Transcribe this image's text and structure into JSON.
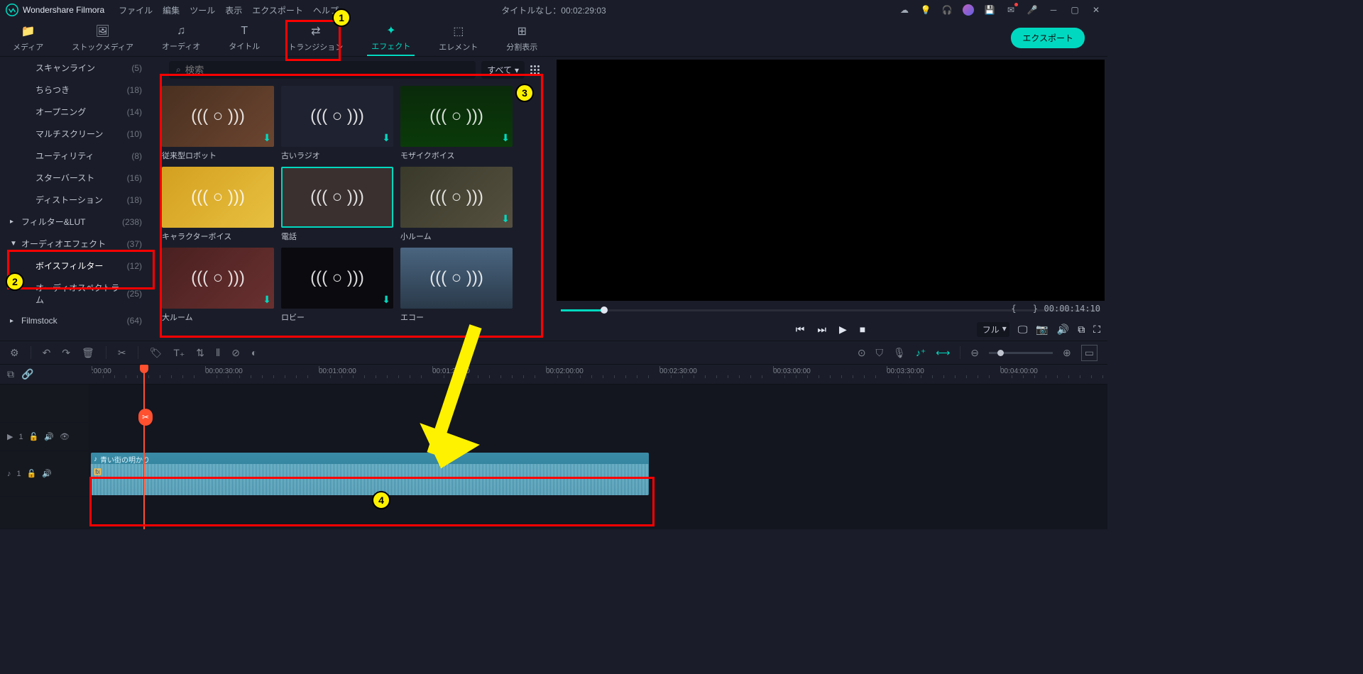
{
  "app": {
    "name": "Wondershare Filmora",
    "title": "タイトルなし：00:02:29:03"
  },
  "menu": [
    "ファイル",
    "編集",
    "ツール",
    "表示",
    "エクスポート",
    "ヘルプ"
  ],
  "tabs": [
    {
      "label": "メディア"
    },
    {
      "label": "ストックメディア"
    },
    {
      "label": "オーディオ"
    },
    {
      "label": "タイトル"
    },
    {
      "label": "トランジション"
    },
    {
      "label": "エフェクト",
      "active": true
    },
    {
      "label": "エレメント"
    },
    {
      "label": "分割表示"
    }
  ],
  "export_btn": "エクスポート",
  "search": {
    "placeholder": "検索",
    "filter_label": "すべて"
  },
  "sidebar": {
    "items": [
      {
        "label": "スキャンライン",
        "count": "(5)",
        "lv": 1
      },
      {
        "label": "ちらつき",
        "count": "(18)",
        "lv": 1
      },
      {
        "label": "オープニング",
        "count": "(14)",
        "lv": 1
      },
      {
        "label": "マルチスクリーン",
        "count": "(10)",
        "lv": 1
      },
      {
        "label": "ユーティリティ",
        "count": "(8)",
        "lv": 1
      },
      {
        "label": "スターバースト",
        "count": "(16)",
        "lv": 1
      },
      {
        "label": "ディストーション",
        "count": "(18)",
        "lv": 1
      },
      {
        "label": "フィルター&LUT",
        "count": "(238)",
        "lv": 0
      },
      {
        "label": "オーディオエフェクト",
        "count": "(37)",
        "lv": 0,
        "open": true
      },
      {
        "label": "ボイスフィルター",
        "count": "(12)",
        "lv": 1,
        "active": true
      },
      {
        "label": "オーディオスペクトラム",
        "count": "(25)",
        "lv": 1
      },
      {
        "label": "Filmstock",
        "count": "(64)",
        "lv": 0
      }
    ]
  },
  "thumbs": [
    {
      "label": "従来型ロボット",
      "bg": "bg1",
      "dl": true
    },
    {
      "label": "古いラジオ",
      "bg": "bg2",
      "dl": true
    },
    {
      "label": "モザイクボイス",
      "bg": "bg3",
      "dl": true
    },
    {
      "label": "キャラクターボイス",
      "bg": "bg4",
      "dl": false
    },
    {
      "label": "電話",
      "bg": "bg5",
      "dl": false,
      "selected": true
    },
    {
      "label": "小ルーム",
      "bg": "bg6",
      "dl": true
    },
    {
      "label": "大ルーム",
      "bg": "bg7",
      "dl": true
    },
    {
      "label": "ロビー",
      "bg": "bg8",
      "dl": true
    },
    {
      "label": "エコー",
      "bg": "bg9",
      "dl": false
    }
  ],
  "preview": {
    "timecode": "00:00:14:10",
    "quality": "フル"
  },
  "timeline": {
    "ticks": [
      ":00:00",
      "00:00:30:00",
      "00:01:00:00",
      "00:01:30:00",
      "00:02:00:00",
      "00:02:30:00",
      "00:03:00:00",
      "00:03:30:00",
      "00:04:00:00"
    ],
    "clip_name": "青い街の明かり",
    "fx_badge": "fx",
    "video_track": "1",
    "audio_track": "1"
  },
  "callouts": {
    "c1": "1",
    "c2": "2",
    "c3": "3",
    "c4": "4"
  }
}
